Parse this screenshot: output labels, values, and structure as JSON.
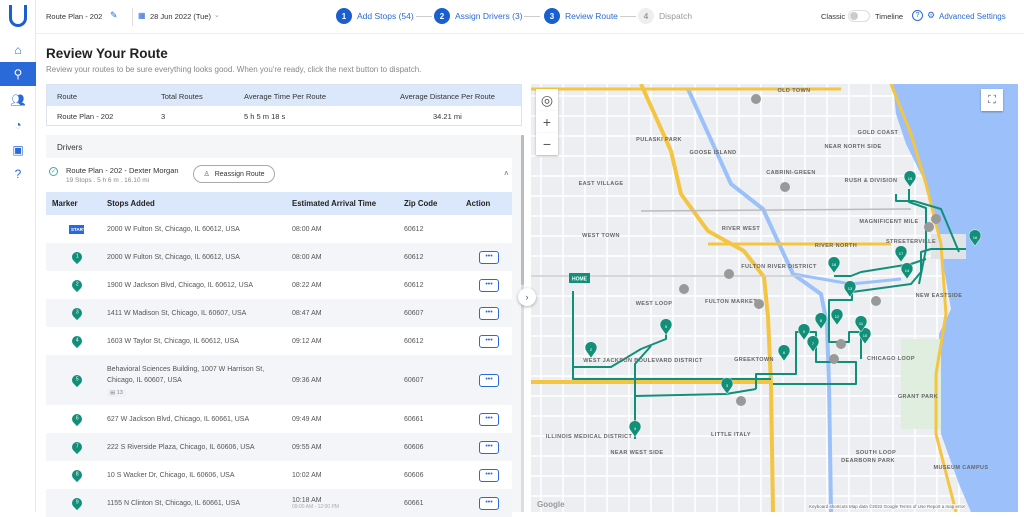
{
  "header": {
    "plan_name": "Route Plan - 202",
    "date": "28 Jun 2022 (Tue)",
    "steps": [
      {
        "num": "1",
        "label": "Add Stops (54)"
      },
      {
        "num": "2",
        "label": "Assign Drivers (3)"
      },
      {
        "num": "3",
        "label": "Review Route"
      },
      {
        "num": "4",
        "label": "Dispatch"
      }
    ],
    "toggle_left": "Classic",
    "toggle_right": "Timeline",
    "advanced": "Advanced Settings"
  },
  "page": {
    "title": "Review Your Route",
    "subtitle": "Review your routes to be sure everything looks good. When you're ready, click the next button to dispatch."
  },
  "summary": {
    "headers": [
      "Route",
      "Total Routes",
      "Average Time Per Route",
      "Average Distance Per Route"
    ],
    "values": [
      "Route Plan - 202",
      "3",
      "5 h 5 m 18 s",
      "34.21 mi"
    ]
  },
  "drivers": {
    "title": "Drivers",
    "route_name": "Route Plan - 202 - Dexter Morgan",
    "route_meta": "19 Stops . 5 h 6 m . 16.10 mi",
    "reassign": "Reassign Route",
    "columns": [
      "Marker",
      "Stops Added",
      "Estimated Arrival Time",
      "Zip Code",
      "Action"
    ],
    "rows": [
      {
        "marker": "START",
        "address": "2000 W Fulton St, Chicago, IL 60612, USA",
        "eta": "08:00 AM",
        "zip": "60612"
      },
      {
        "marker": "1",
        "address": "2000 W Fulton St, Chicago, IL 60612, USA",
        "eta": "08:00 AM",
        "zip": "60612"
      },
      {
        "marker": "2",
        "address": "1900 W Jackson Blvd, Chicago, IL 60612, USA",
        "eta": "08:22 AM",
        "zip": "60612"
      },
      {
        "marker": "3",
        "address": "1411 W Madison St, Chicago, IL 60607, USA",
        "eta": "08:47 AM",
        "zip": "60607"
      },
      {
        "marker": "4",
        "address": "1603 W Taylor St, Chicago, IL 60612, USA",
        "eta": "09:12 AM",
        "zip": "60612"
      },
      {
        "marker": "5",
        "address": "Behavioral Sciences Building, 1007 W Harrison St, Chicago, IL 60607, USA",
        "badge": "13",
        "eta": "09:36 AM",
        "zip": "60607"
      },
      {
        "marker": "6",
        "address": "627 W Jackson Blvd, Chicago, IL 60661, USA",
        "eta": "09:49 AM",
        "zip": "60661"
      },
      {
        "marker": "7",
        "address": "222 S Riverside Plaza, Chicago, IL 60606, USA",
        "eta": "09:55 AM",
        "zip": "60606"
      },
      {
        "marker": "8",
        "address": "10 S Wacker Dr, Chicago, IL 60606, USA",
        "eta": "10:02 AM",
        "zip": "60606"
      },
      {
        "marker": "9",
        "address": "1155 N Clinton St, Chicago, IL 60661, USA",
        "eta": "10:18 AM",
        "window": "09:00 AM - 12:00 PM",
        "zip": "60661"
      }
    ]
  },
  "map": {
    "home_label": "HOME",
    "google": "Google",
    "footer": "Keyboard shortcuts   Map data ©2022 Google   Terms of Use   Report a map error",
    "areas": [
      "OLD TOWN",
      "PULASKI PARK",
      "GOOSE ISLAND",
      "GOLD COAST",
      "NEAR NORTH SIDE",
      "CABRINI-GREEN",
      "RUSH & DIVISION",
      "EAST VILLAGE",
      "WEST TOWN",
      "RIVER WEST",
      "MAGNIFICENT MILE",
      "RIVER NORTH",
      "STREETERVILLE",
      "FULTON RIVER DISTRICT",
      "NEW EASTSIDE",
      "WEST LOOP",
      "FULTON MARKET",
      "GREEKTOWN",
      "WEST JACKSON BOULEVARD DISTRICT",
      "CHICAGO LOOP",
      "GRANT PARK",
      "ILLINOIS MEDICAL DISTRICT",
      "LITTLE ITALY",
      "NEAR WEST SIDE",
      "SOUTH LOOP",
      "DEARBORN PARK",
      "MUSEUM CAMPUS"
    ],
    "markers": [
      "2",
      "3",
      "4",
      "5",
      "6",
      "7",
      "8",
      "9",
      "10",
      "11",
      "12",
      "13",
      "14",
      "15",
      "16",
      "17",
      "18"
    ],
    "route_color": "#128f79",
    "water_color": "#9cc0f9",
    "highway_color": "#f4c542"
  },
  "colors": {
    "primary": "#2a6ad8",
    "header_bg": "#dbe8fb"
  }
}
